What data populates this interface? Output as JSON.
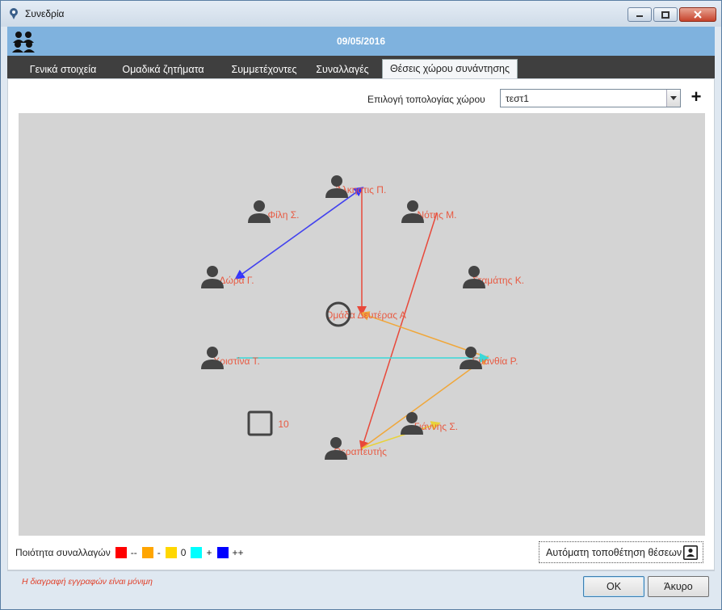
{
  "window": {
    "title": "Συνεδρία"
  },
  "header": {
    "date": "09/05/2016"
  },
  "tabs": [
    {
      "label": "Γενικά στοιχεία"
    },
    {
      "label": "Ομαδικά ζητήματα"
    },
    {
      "label": "Συμμετέχοντες"
    },
    {
      "label": "Συναλλαγές"
    },
    {
      "label": "Θέσεις χώρου συνάντησης",
      "active": true
    }
  ],
  "topology": {
    "label": "Επιλογή τοπολογίας χώρου",
    "selected": "τεστ1",
    "add_symbol": "+"
  },
  "canvas": {
    "participants": [
      {
        "name": "Άλκηστις Π.",
        "type": "person"
      },
      {
        "name": "Φίλη Σ.",
        "type": "person"
      },
      {
        "name": "Νότης Μ.",
        "type": "person"
      },
      {
        "name": "Δώρα Γ.",
        "type": "person"
      },
      {
        "name": "Σταμάτης Κ.",
        "type": "person"
      },
      {
        "name": "Χριστίνα Τ.",
        "type": "person"
      },
      {
        "name": "Ευανθία Ρ.",
        "type": "person"
      },
      {
        "name": "Γιάννης Σ.",
        "type": "person"
      },
      {
        "name": "Θεραπευτής",
        "type": "person"
      }
    ],
    "group": {
      "name": "Ομάδα Δευτέρας Α"
    },
    "seat": {
      "label": "10"
    }
  },
  "legend": {
    "title": "Ποιότητα συναλλαγών",
    "items": [
      {
        "color": "#ff0000",
        "label": "--"
      },
      {
        "color": "#ffa500",
        "label": "-"
      },
      {
        "color": "#ffd700",
        "label": "0"
      },
      {
        "color": "#00ffff",
        "label": "+"
      },
      {
        "color": "#0000ff",
        "label": "++"
      }
    ]
  },
  "auto_place": {
    "label": "Αυτόματη τοποθέτηση θέσεων"
  },
  "notice": "Η διαγραφή εγγραφών είναι μόνιμη",
  "buttons": {
    "ok": "OK",
    "cancel": "Άκυρο"
  }
}
